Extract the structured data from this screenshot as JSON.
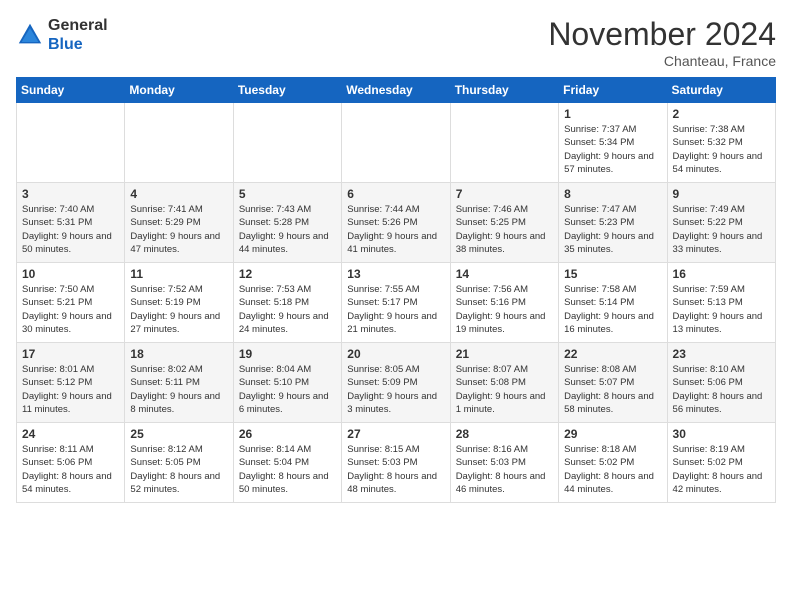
{
  "logo": {
    "line1": "General",
    "line2": "Blue"
  },
  "title": "November 2024",
  "location": "Chanteau, France",
  "headers": [
    "Sunday",
    "Monday",
    "Tuesday",
    "Wednesday",
    "Thursday",
    "Friday",
    "Saturday"
  ],
  "weeks": [
    [
      {
        "day": "",
        "info": ""
      },
      {
        "day": "",
        "info": ""
      },
      {
        "day": "",
        "info": ""
      },
      {
        "day": "",
        "info": ""
      },
      {
        "day": "",
        "info": ""
      },
      {
        "day": "1",
        "info": "Sunrise: 7:37 AM\nSunset: 5:34 PM\nDaylight: 9 hours and 57 minutes."
      },
      {
        "day": "2",
        "info": "Sunrise: 7:38 AM\nSunset: 5:32 PM\nDaylight: 9 hours and 54 minutes."
      }
    ],
    [
      {
        "day": "3",
        "info": "Sunrise: 7:40 AM\nSunset: 5:31 PM\nDaylight: 9 hours and 50 minutes."
      },
      {
        "day": "4",
        "info": "Sunrise: 7:41 AM\nSunset: 5:29 PM\nDaylight: 9 hours and 47 minutes."
      },
      {
        "day": "5",
        "info": "Sunrise: 7:43 AM\nSunset: 5:28 PM\nDaylight: 9 hours and 44 minutes."
      },
      {
        "day": "6",
        "info": "Sunrise: 7:44 AM\nSunset: 5:26 PM\nDaylight: 9 hours and 41 minutes."
      },
      {
        "day": "7",
        "info": "Sunrise: 7:46 AM\nSunset: 5:25 PM\nDaylight: 9 hours and 38 minutes."
      },
      {
        "day": "8",
        "info": "Sunrise: 7:47 AM\nSunset: 5:23 PM\nDaylight: 9 hours and 35 minutes."
      },
      {
        "day": "9",
        "info": "Sunrise: 7:49 AM\nSunset: 5:22 PM\nDaylight: 9 hours and 33 minutes."
      }
    ],
    [
      {
        "day": "10",
        "info": "Sunrise: 7:50 AM\nSunset: 5:21 PM\nDaylight: 9 hours and 30 minutes."
      },
      {
        "day": "11",
        "info": "Sunrise: 7:52 AM\nSunset: 5:19 PM\nDaylight: 9 hours and 27 minutes."
      },
      {
        "day": "12",
        "info": "Sunrise: 7:53 AM\nSunset: 5:18 PM\nDaylight: 9 hours and 24 minutes."
      },
      {
        "day": "13",
        "info": "Sunrise: 7:55 AM\nSunset: 5:17 PM\nDaylight: 9 hours and 21 minutes."
      },
      {
        "day": "14",
        "info": "Sunrise: 7:56 AM\nSunset: 5:16 PM\nDaylight: 9 hours and 19 minutes."
      },
      {
        "day": "15",
        "info": "Sunrise: 7:58 AM\nSunset: 5:14 PM\nDaylight: 9 hours and 16 minutes."
      },
      {
        "day": "16",
        "info": "Sunrise: 7:59 AM\nSunset: 5:13 PM\nDaylight: 9 hours and 13 minutes."
      }
    ],
    [
      {
        "day": "17",
        "info": "Sunrise: 8:01 AM\nSunset: 5:12 PM\nDaylight: 9 hours and 11 minutes."
      },
      {
        "day": "18",
        "info": "Sunrise: 8:02 AM\nSunset: 5:11 PM\nDaylight: 9 hours and 8 minutes."
      },
      {
        "day": "19",
        "info": "Sunrise: 8:04 AM\nSunset: 5:10 PM\nDaylight: 9 hours and 6 minutes."
      },
      {
        "day": "20",
        "info": "Sunrise: 8:05 AM\nSunset: 5:09 PM\nDaylight: 9 hours and 3 minutes."
      },
      {
        "day": "21",
        "info": "Sunrise: 8:07 AM\nSunset: 5:08 PM\nDaylight: 9 hours and 1 minute."
      },
      {
        "day": "22",
        "info": "Sunrise: 8:08 AM\nSunset: 5:07 PM\nDaylight: 8 hours and 58 minutes."
      },
      {
        "day": "23",
        "info": "Sunrise: 8:10 AM\nSunset: 5:06 PM\nDaylight: 8 hours and 56 minutes."
      }
    ],
    [
      {
        "day": "24",
        "info": "Sunrise: 8:11 AM\nSunset: 5:06 PM\nDaylight: 8 hours and 54 minutes."
      },
      {
        "day": "25",
        "info": "Sunrise: 8:12 AM\nSunset: 5:05 PM\nDaylight: 8 hours and 52 minutes."
      },
      {
        "day": "26",
        "info": "Sunrise: 8:14 AM\nSunset: 5:04 PM\nDaylight: 8 hours and 50 minutes."
      },
      {
        "day": "27",
        "info": "Sunrise: 8:15 AM\nSunset: 5:03 PM\nDaylight: 8 hours and 48 minutes."
      },
      {
        "day": "28",
        "info": "Sunrise: 8:16 AM\nSunset: 5:03 PM\nDaylight: 8 hours and 46 minutes."
      },
      {
        "day": "29",
        "info": "Sunrise: 8:18 AM\nSunset: 5:02 PM\nDaylight: 8 hours and 44 minutes."
      },
      {
        "day": "30",
        "info": "Sunrise: 8:19 AM\nSunset: 5:02 PM\nDaylight: 8 hours and 42 minutes."
      }
    ]
  ]
}
